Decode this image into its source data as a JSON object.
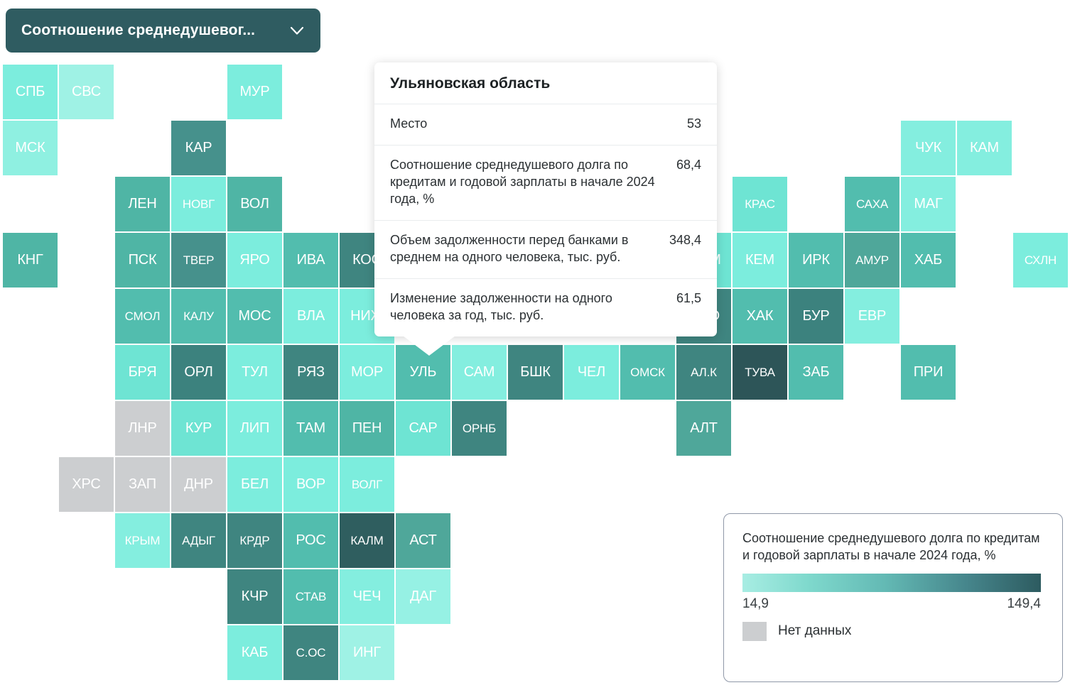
{
  "selector": {
    "label": "Соотношение среднедушевог...",
    "icon": "chevron-down-icon"
  },
  "tooltip": {
    "title": "Ульяновская область",
    "rows": [
      {
        "key": "Место",
        "value": "53"
      },
      {
        "key": "Соотношение среднедушевого долга по кредитам и годовой зарплаты в начале 2024 года, %",
        "value": "68,4"
      },
      {
        "key": "Объем задолженности перед банками в среднем на одного человека, тыс. руб.",
        "value": "348,4"
      },
      {
        "key": "Изменение задолженности на одного человека за год, тыс. руб.",
        "value": "61,5"
      }
    ]
  },
  "legend": {
    "title": "Соотношение среднедушевого долга по кредитам и годовой зарплаты в начале 2024 года, %",
    "min": "14,9",
    "max": "149,4",
    "nodata_label": "Нет данных",
    "gradient_from": "#a8ede3",
    "gradient_to": "#2d5b60",
    "nodata_color": "#ccced0"
  },
  "chart_data": {
    "type": "heatmap",
    "title": "Соотношение среднедушевого долга по кредитам и годовой зарплаты в начале 2024 года, %",
    "colorscale_min": 14.9,
    "colorscale_max": 149.4,
    "nodata_color": "#ccced0",
    "selected": "УЛЬ",
    "tiles": [
      {
        "code": "СПБ",
        "col": 0,
        "row": 0,
        "color": "#7ceddd"
      },
      {
        "code": "СВС",
        "col": 1,
        "row": 0,
        "color": "#9ff2e5"
      },
      {
        "code": "МУР",
        "col": 4,
        "row": 0,
        "color": "#7ceddd"
      },
      {
        "code": "МСК",
        "col": 0,
        "row": 1,
        "color": "#8ff0e1"
      },
      {
        "code": "КАР",
        "col": 3,
        "row": 1,
        "color": "#46918c"
      },
      {
        "code": "ЧУК",
        "col": 16,
        "row": 1,
        "color": "#84eedf"
      },
      {
        "code": "КАМ",
        "col": 17,
        "row": 1,
        "color": "#84eedf"
      },
      {
        "code": "ЛЕН",
        "col": 2,
        "row": 2,
        "color": "#4fb5a5"
      },
      {
        "code": "НОВГ",
        "col": 3,
        "row": 2,
        "color": "#7ceddd"
      },
      {
        "code": "ВОЛ",
        "col": 4,
        "row": 2,
        "color": "#4fb5a5"
      },
      {
        "code": "КРАС",
        "col": 13,
        "row": 2,
        "color": "#6ee4d3"
      },
      {
        "code": "САХА",
        "col": 15,
        "row": 2,
        "color": "#52bdae"
      },
      {
        "code": "МАГ",
        "col": 16,
        "row": 2,
        "color": "#84eedf"
      },
      {
        "code": "КНГ",
        "col": 0,
        "row": 3,
        "color": "#4fb5a5"
      },
      {
        "code": "ПСК",
        "col": 2,
        "row": 3,
        "color": "#4fb5a5"
      },
      {
        "code": "ТВЕР",
        "col": 3,
        "row": 3,
        "color": "#46918c"
      },
      {
        "code": "ЯРО",
        "col": 4,
        "row": 3,
        "color": "#7ceddd"
      },
      {
        "code": "ИВА",
        "col": 5,
        "row": 3,
        "color": "#52bdae"
      },
      {
        "code": "КОС",
        "col": 6,
        "row": 3,
        "color": "#3f8580"
      },
      {
        "code": "ТЮМ",
        "col": 12,
        "row": 3,
        "color": "#6ee4d3"
      },
      {
        "code": "КЕМ",
        "col": 13,
        "row": 3,
        "color": "#7ceddd"
      },
      {
        "code": "ИРК",
        "col": 14,
        "row": 3,
        "color": "#52bdae"
      },
      {
        "code": "АМУР",
        "col": 15,
        "row": 3,
        "color": "#4fa79a"
      },
      {
        "code": "ХАБ",
        "col": 16,
        "row": 3,
        "color": "#52bdae"
      },
      {
        "code": "СХЛН",
        "col": 18,
        "row": 3,
        "color": "#7ceddd"
      },
      {
        "code": "СМОЛ",
        "col": 2,
        "row": 4,
        "color": "#52bdae"
      },
      {
        "code": "КАЛУ",
        "col": 3,
        "row": 4,
        "color": "#52bdae"
      },
      {
        "code": "МОС",
        "col": 4,
        "row": 4,
        "color": "#52bdae"
      },
      {
        "code": "ВЛА",
        "col": 5,
        "row": 4,
        "color": "#7ceddd"
      },
      {
        "code": "НИЖ",
        "col": 6,
        "row": 4,
        "color": "#7ceddd"
      },
      {
        "code": "ХМО",
        "col": 12,
        "row": 4,
        "color": "#3f8580"
      },
      {
        "code": "ХАК",
        "col": 13,
        "row": 4,
        "color": "#52bdae"
      },
      {
        "code": "БУР",
        "col": 14,
        "row": 4,
        "color": "#3c827e"
      },
      {
        "code": "ЕВР",
        "col": 15,
        "row": 4,
        "color": "#84eedf"
      },
      {
        "code": "БРЯ",
        "col": 2,
        "row": 5,
        "color": "#6ee4d3"
      },
      {
        "code": "ОРЛ",
        "col": 3,
        "row": 5,
        "color": "#3c827e"
      },
      {
        "code": "ТУЛ",
        "col": 4,
        "row": 5,
        "color": "#7ceddd"
      },
      {
        "code": "РЯЗ",
        "col": 5,
        "row": 5,
        "color": "#3f8580"
      },
      {
        "code": "МОР",
        "col": 6,
        "row": 5,
        "color": "#7ceddd"
      },
      {
        "code": "УЛЬ",
        "col": 7,
        "row": 5,
        "color": "#52bdae"
      },
      {
        "code": "САМ",
        "col": 8,
        "row": 5,
        "color": "#84eedf"
      },
      {
        "code": "БШК",
        "col": 9,
        "row": 5,
        "color": "#3f8580"
      },
      {
        "code": "ЧЕЛ",
        "col": 10,
        "row": 5,
        "color": "#7ceddd"
      },
      {
        "code": "ОМСК",
        "col": 11,
        "row": 5,
        "color": "#52bdae"
      },
      {
        "code": "АЛ.К",
        "col": 12,
        "row": 5,
        "color": "#3f8580"
      },
      {
        "code": "ТУВА",
        "col": 13,
        "row": 5,
        "color": "#2d5558"
      },
      {
        "code": "ЗАБ",
        "col": 14,
        "row": 5,
        "color": "#52bdae"
      },
      {
        "code": "ПРИ",
        "col": 16,
        "row": 5,
        "color": "#52bdae"
      },
      {
        "code": "ЛНР",
        "col": 2,
        "row": 6,
        "color": "#ccced0"
      },
      {
        "code": "КУР",
        "col": 3,
        "row": 6,
        "color": "#6ee4d3"
      },
      {
        "code": "ЛИП",
        "col": 4,
        "row": 6,
        "color": "#7ceddd"
      },
      {
        "code": "ТАМ",
        "col": 5,
        "row": 6,
        "color": "#52bdae"
      },
      {
        "code": "ПЕН",
        "col": 6,
        "row": 6,
        "color": "#4fb5a5"
      },
      {
        "code": "САР",
        "col": 7,
        "row": 6,
        "color": "#6ee4d3"
      },
      {
        "code": "ОРНБ",
        "col": 8,
        "row": 6,
        "color": "#3f8580"
      },
      {
        "code": "АЛТ",
        "col": 12,
        "row": 6,
        "color": "#4fa79a"
      },
      {
        "code": "ХРС",
        "col": 1,
        "row": 7,
        "color": "#ccced0"
      },
      {
        "code": "ЗАП",
        "col": 2,
        "row": 7,
        "color": "#ccced0"
      },
      {
        "code": "ДНР",
        "col": 3,
        "row": 7,
        "color": "#ccced0"
      },
      {
        "code": "БЕЛ",
        "col": 4,
        "row": 7,
        "color": "#7ceddd"
      },
      {
        "code": "ВОР",
        "col": 5,
        "row": 7,
        "color": "#7ceddd"
      },
      {
        "code": "ВОЛГ",
        "col": 6,
        "row": 7,
        "color": "#7ceddd"
      },
      {
        "code": "КРЫМ",
        "col": 2,
        "row": 8,
        "color": "#84eedf"
      },
      {
        "code": "АДЫГ",
        "col": 3,
        "row": 8,
        "color": "#3f8580"
      },
      {
        "code": "КРДР",
        "col": 4,
        "row": 8,
        "color": "#3f8580"
      },
      {
        "code": "РОС",
        "col": 5,
        "row": 8,
        "color": "#52bdae"
      },
      {
        "code": "КАЛМ",
        "col": 6,
        "row": 8,
        "color": "#2f5e5f"
      },
      {
        "code": "АСТ",
        "col": 7,
        "row": 8,
        "color": "#4fa79a"
      },
      {
        "code": "КЧР",
        "col": 4,
        "row": 9,
        "color": "#3f8580"
      },
      {
        "code": "СТАВ",
        "col": 5,
        "row": 9,
        "color": "#52bdae"
      },
      {
        "code": "ЧЕЧ",
        "col": 6,
        "row": 9,
        "color": "#84eedf"
      },
      {
        "code": "ДАГ",
        "col": 7,
        "row": 9,
        "color": "#96f1e4"
      },
      {
        "code": "КАБ",
        "col": 4,
        "row": 10,
        "color": "#7ceddd"
      },
      {
        "code": "С.ОС",
        "col": 5,
        "row": 10,
        "color": "#3f8580"
      },
      {
        "code": "ИНГ",
        "col": 6,
        "row": 10,
        "color": "#9ff2e5"
      }
    ]
  }
}
